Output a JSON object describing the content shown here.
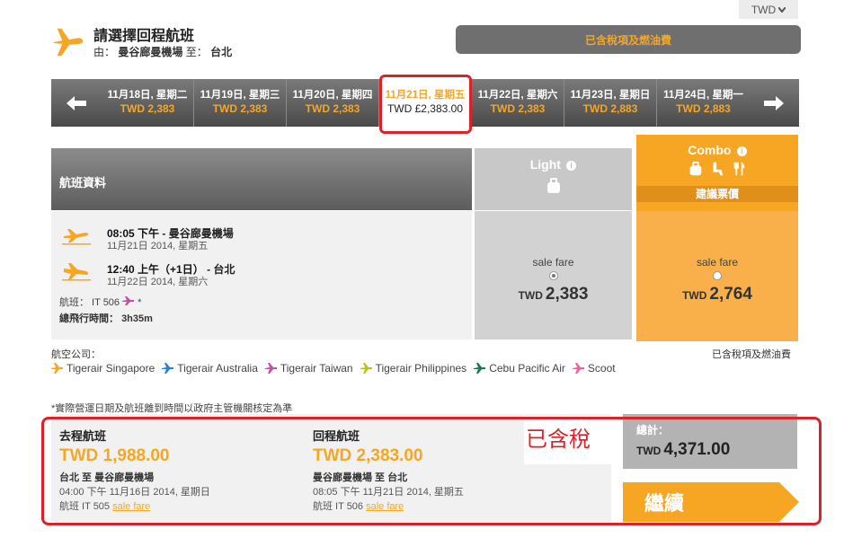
{
  "currency": {
    "value": "TWD"
  },
  "header": {
    "title": "請選擇回程航班",
    "from_label": "由：",
    "from": "曼谷廊曼機場",
    "to_label": "至：",
    "to": "台北"
  },
  "tax_bar": {
    "label": "已含稅項及燃油費"
  },
  "dates": [
    {
      "date": "11月18日, 星期二",
      "price": "TWD 2,383"
    },
    {
      "date": "11月19日, 星期三",
      "price": "TWD 2,383"
    },
    {
      "date": "11月20日, 星期四",
      "price": "TWD 2,383"
    },
    {
      "date": "11月21日, 星期五",
      "price": "TWD £2,383.00"
    },
    {
      "date": "11月22日, 星期六",
      "price": "TWD 2,383"
    },
    {
      "date": "11月23日, 星期日",
      "price": "TWD 2,883"
    },
    {
      "date": "11月24日, 星期一",
      "price": "TWD 2,883"
    }
  ],
  "table": {
    "info_header": "航班資料",
    "light_label": "Light",
    "combo_label": "Combo",
    "recommended": "建議票價"
  },
  "flight": {
    "dep_time": "08:05 下午",
    "dep_place": "- 曼谷廊曼機場",
    "dep_date": "11月21日 2014, 星期五",
    "arr_time": "12:40 上午（+1日）",
    "arr_place": "- 台北",
    "arr_date": "11月22日 2014, 星期六",
    "flight_no": "航班： IT 506",
    "duration_label": "總飛行時間：",
    "duration": "3h35m"
  },
  "fares": {
    "light": {
      "label": "sale fare",
      "currency": "TWD",
      "amount": "2,383"
    },
    "combo": {
      "label": "sale fare",
      "currency": "TWD",
      "amount": "2,764"
    }
  },
  "airlines": {
    "label": "航空公司：",
    "tax_note": "已含稅項及燃油費",
    "items": [
      {
        "name": "Tigerair Singapore",
        "color": "#f6a623"
      },
      {
        "name": "Tigerair Australia",
        "color": "#2a7fd6"
      },
      {
        "name": "Tigerair Taiwan",
        "color": "#c24fa8"
      },
      {
        "name": "Tigerair Philippines",
        "color": "#b8c61a"
      },
      {
        "name": "Cebu Pacific Air",
        "color": "#1c7a4a"
      },
      {
        "name": "Scoot",
        "color": "#f060a8"
      }
    ]
  },
  "disclaimer": "*實際營運日期及航班離到時間以政府主管機關核定為準",
  "summary": {
    "outbound": {
      "title": "去程航班",
      "amount": "TWD 1,988.00",
      "route": "台北 至 曼谷廊曼機場",
      "datetime": "04:00 下午 11月16日 2014, 星期日",
      "flight_prefix": "航班 IT 505",
      "fare_link": "sale fare"
    },
    "return": {
      "title": "回程航班",
      "amount": "TWD 2,383.00",
      "route": "曼谷廊曼機場 至 台北",
      "datetime": "08:05 下午 11月21日 2014, 星期五",
      "flight_prefix": "航班 IT 506",
      "fare_link": "sale fare"
    },
    "tax_annotation": "已含稅"
  },
  "total": {
    "label": "總計：",
    "currency": "TWD",
    "amount": "4,371.00"
  },
  "continue": {
    "label": "繼續"
  },
  "colors": {
    "brand_orange": "#f6a623",
    "highlight_red": "#d9232b"
  }
}
